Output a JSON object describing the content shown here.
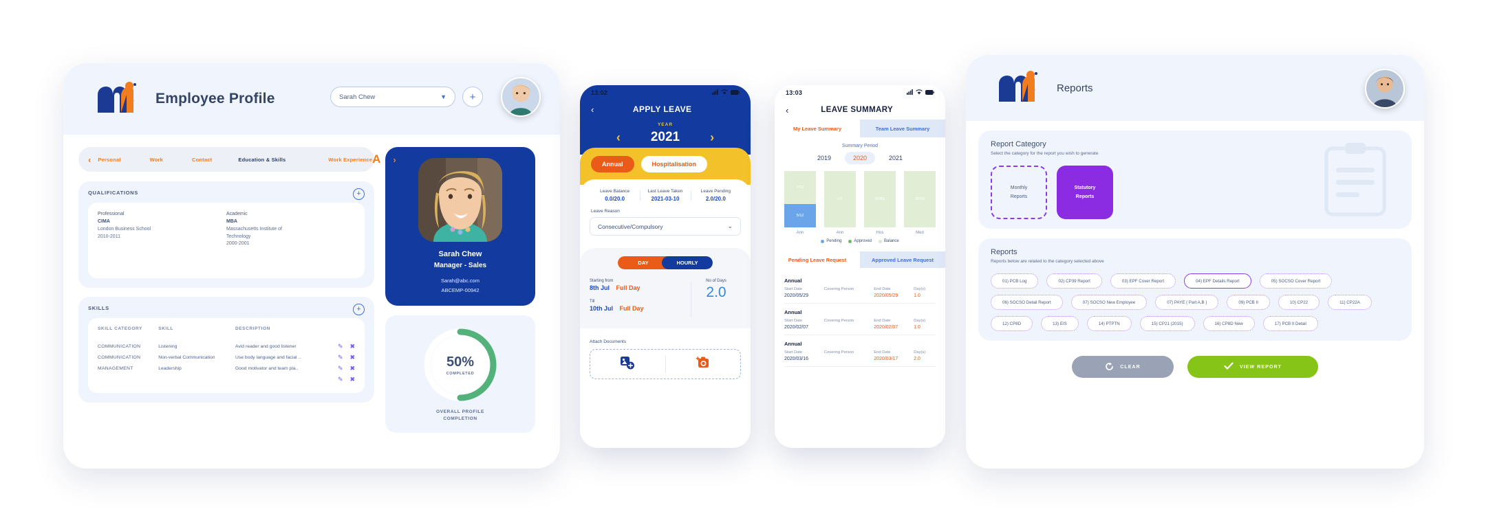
{
  "profile": {
    "app_title": "Employee Profile",
    "logo_text": "mi hcm",
    "employee_select": {
      "value": "Sarah Chew",
      "chevron_icon": "chevron-down-icon"
    },
    "add_button_label": "+",
    "tabs": [
      {
        "label": "Personal",
        "active": false
      },
      {
        "label": "Work",
        "active": false
      },
      {
        "label": "Contact",
        "active": false
      },
      {
        "label": "Education & Skills",
        "active": true
      },
      {
        "label": "Work Experience",
        "active": false
      }
    ],
    "tab_prev_icon": "chevron-left-icon",
    "tab_next_icon": "chevron-right-icon",
    "tab_letter": "A",
    "qualifications": {
      "title": "QUALIFICATIONS",
      "add_label": "+",
      "professional": {
        "heading": "Professional",
        "name": "CIMA",
        "institution": "London Business School",
        "years": "2010-2011"
      },
      "academic": {
        "heading": "Academic",
        "name": "MBA",
        "institution": "Massachusetts Institute of",
        "institution2": "Technology",
        "years": "2000-2001"
      }
    },
    "skills": {
      "title": "SKILLS",
      "add_label": "+",
      "columns": [
        "SKILL CATEGORY",
        "SKILL",
        "DESCRIPTION"
      ],
      "rows": [
        {
          "category": "COMMUNICATION",
          "skill": "Listening",
          "description": "Avid reader and good listener"
        },
        {
          "category": "COMMUNICATION",
          "skill": "Non-verbal Communication",
          "description": "Use body language and facial .."
        },
        {
          "category": "MANAGEMENT",
          "skill": "Leadership",
          "description": "Good motivator and team pla.."
        }
      ],
      "edit_icon": "pencil-icon",
      "delete_icon": "close-icon"
    },
    "id_card": {
      "name": "Sarah Chew",
      "role": "Manager - Sales",
      "email": "Sarah@abc.com",
      "employee_id": "ABCEMP-00942"
    },
    "completion": {
      "percent_label": "50%",
      "completed_label": "COMPLETED",
      "caption_line1": "OVERALL PROFILE",
      "caption_line2": "COMPLETION",
      "percent": 50,
      "arc_color": "#52b27a"
    }
  },
  "apply_leave": {
    "status_time": "13:02",
    "back_icon": "chevron-left-icon",
    "title": "APPLY LEAVE",
    "year_label": "YEAR",
    "year_value": "2021",
    "year_prev_icon": "chevron-left-icon",
    "year_next_icon": "chevron-right-icon",
    "type_chips": [
      {
        "label": "Annual",
        "selected": true
      },
      {
        "label": "Hospitalisation",
        "selected": false
      }
    ],
    "stats": [
      {
        "key": "Leave Balance",
        "value": "0.0/20.0"
      },
      {
        "key": "Last Leave Taken",
        "value": "2021-03-10"
      },
      {
        "key": "Leave Pending",
        "value": "2.0/20.0"
      }
    ],
    "reason_label": "Leave Reason",
    "reason_value": "Consecutive/Compulsory",
    "reason_chevron": "chevron-down-icon",
    "mode_toggle": [
      {
        "label": "DAY",
        "selected": true
      },
      {
        "label": "HOURLY",
        "selected": false
      }
    ],
    "start_key": "Starting from",
    "start_date": "8th Jul",
    "start_part": "Full Day",
    "till_key": "Till",
    "till_date": "10th Jul",
    "till_part": "Full Day",
    "days_key": "No of Days",
    "days_value": "2.0",
    "attach_label": "Attach Documents",
    "attach_gallery_icon": "image-add-icon",
    "attach_camera_icon": "camera-add-icon"
  },
  "leave_summary": {
    "status_time": "13:03",
    "back_icon": "chevron-left-icon",
    "title": "LEAVE SUMMARY",
    "tabs": [
      {
        "label": "My Leave Summary",
        "active": true
      },
      {
        "label": "Team Leave Summary",
        "active": false
      }
    ],
    "period_label": "Summary Period",
    "years": [
      {
        "label": "2019",
        "selected": false
      },
      {
        "label": "2020",
        "selected": true
      },
      {
        "label": "2021",
        "selected": false
      }
    ],
    "request_tabs": [
      {
        "label": "Pending Leave Request",
        "active": true
      },
      {
        "label": "Approved Leave Request",
        "active": false
      }
    ],
    "request_columns": {
      "start": "Start Date",
      "covering": "Covering Person",
      "end": "End Date",
      "days": "Day(s)"
    },
    "requests": [
      {
        "type": "Annual",
        "start": "2020/05/29",
        "covering": "",
        "end": "2020/05/29",
        "days": "1.0"
      },
      {
        "type": "Annual",
        "start": "2020/02/07",
        "covering": "",
        "end": "2020/02/07",
        "days": "1.0"
      },
      {
        "type": "Annual",
        "start": "2020/03/16",
        "covering": "",
        "end": "2020/03/17",
        "days": "2.0"
      }
    ],
    "chart_data": {
      "type": "bar",
      "title": "Leave Summary",
      "stacked": true,
      "categories": [
        "Ann",
        "Ann",
        "Hos",
        "Med"
      ],
      "series": [
        {
          "name": "Pending",
          "color": "#6ba5e9",
          "values": [
            5,
            0,
            0,
            0
          ],
          "labels": [
            "5/12",
            "",
            "",
            ""
          ]
        },
        {
          "name": "Approved",
          "color": "#6bbd5b",
          "values": [
            0,
            0,
            0,
            0
          ],
          "labels": [
            "",
            "",
            "",
            ""
          ]
        },
        {
          "name": "Balance",
          "color": "#e2edd5",
          "values": [
            7,
            1,
            60,
            20
          ],
          "labels": [
            "7/12",
            "1/1",
            "60/60",
            "20/20"
          ]
        }
      ],
      "legend": [
        "Pending",
        "Approved",
        "Balance"
      ],
      "legend_position": "bottom",
      "grid": false,
      "xlabel": "",
      "ylabel": ""
    }
  },
  "reports": {
    "app_title": "Reports",
    "logo_text": "mi hcm",
    "category": {
      "title": "Report Category",
      "subtitle": "Select the category for the report you wish to generate",
      "cards": [
        {
          "line1": "Monthly",
          "line2": "Reports",
          "selected": false
        },
        {
          "line1": "Statutory",
          "line2": "Reports",
          "selected": true
        }
      ],
      "clipboard_icon": "clipboard-icon"
    },
    "list": {
      "title": "Reports",
      "subtitle": "Reports below are related to the category selected above",
      "chips": [
        {
          "label": "01) PCB Log",
          "selected": false
        },
        {
          "label": "02) CP39 Report",
          "selected": false
        },
        {
          "label": "03) EPF Cover Report",
          "selected": false
        },
        {
          "label": "04) EPF Details Report",
          "selected": true
        },
        {
          "label": "05) SOCSO Cover Report",
          "selected": false
        },
        {
          "label": "06) SOCSO Detail Report",
          "selected": false
        },
        {
          "label": "07) SOCSO New Employee",
          "selected": false
        },
        {
          "label": "07) PAYE ( Part A,B )",
          "selected": false
        },
        {
          "label": "09) PCB II",
          "selected": false
        },
        {
          "label": "10) CP22",
          "selected": false
        },
        {
          "label": "11) CP22A",
          "selected": false
        },
        {
          "label": "12) CP8D",
          "selected": false
        },
        {
          "label": "13) EIS",
          "selected": false
        },
        {
          "label": "14) PTPTN",
          "selected": false
        },
        {
          "label": "15) CP21 (2015)",
          "selected": false
        },
        {
          "label": "16) CP8D New",
          "selected": false
        },
        {
          "label": "17) PCB II Detail",
          "selected": false
        }
      ]
    },
    "buttons": {
      "clear": {
        "label": "CLEAR",
        "icon": "refresh-icon",
        "color": "#9aa3b5"
      },
      "view": {
        "label": "VIEW REPORT",
        "icon": "check-icon",
        "color": "#86c517"
      }
    }
  }
}
